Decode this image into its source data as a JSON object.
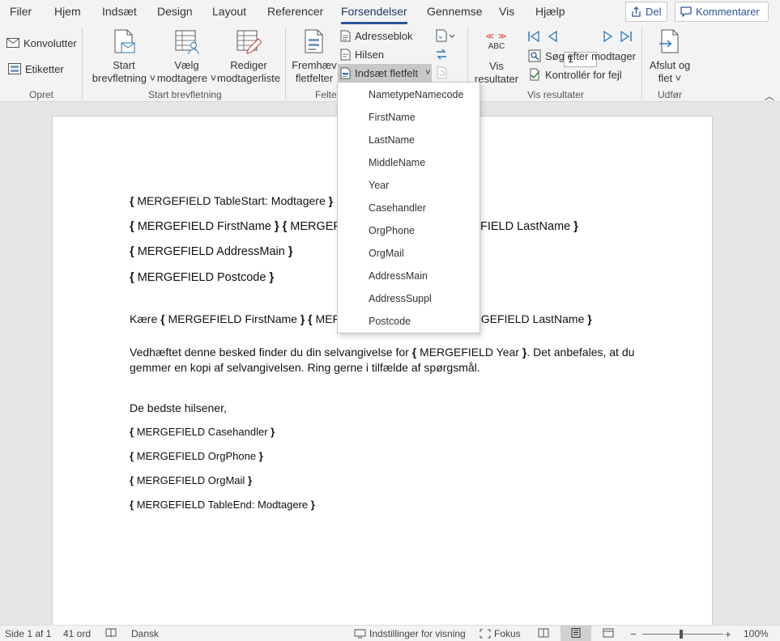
{
  "tabs": [
    "Filer",
    "Hjem",
    "Indsæt",
    "Design",
    "Layout",
    "Referencer",
    "Forsendelser",
    "Gennemse",
    "Vis",
    "Hjælp"
  ],
  "share_label": "Del",
  "comments_label": "Kommentarer",
  "groups": {
    "opret": {
      "label": "Opret",
      "envelopes": "Konvolutter",
      "labels": "Etiketter"
    },
    "start": {
      "label": "Start brevfletning",
      "start_line1": "Start",
      "start_line2": "brevfletning",
      "select_line1": "Vælg",
      "select_line2": "modtagere",
      "edit_line1": "Rediger",
      "edit_line2": "modtagerliste"
    },
    "fields": {
      "label": "Felter",
      "highlight_line1": "Fremhæv",
      "highlight_line2": "fletfelter",
      "address_block": "Adresseblok",
      "greeting": "Hilsen",
      "insert_field": "Indsæt fletfelt"
    },
    "preview": {
      "label": "Vis resultater",
      "preview_line1": "Vis",
      "preview_line2": "resultater",
      "abc_text": "ABC",
      "record_value": "1",
      "find_recipient": "Søg efter modtager",
      "check_errors": "Kontrollér for fejl"
    },
    "finish": {
      "label": "Udfør",
      "finish_line1": "Afslut og",
      "finish_line2": "flet"
    }
  },
  "dropdown_fields": [
    "NametypeNamecode",
    "FirstName",
    "LastName",
    "MiddleName",
    "Year",
    "Casehandler",
    "OrgPhone",
    "OrgMail",
    "AddressMain",
    "AddressSuppl",
    "Postcode"
  ],
  "document": {
    "table_start": "MERGEFIELD TableStart: Modtagere",
    "name_line_a": "MERGEFIELD FirstName",
    "name_line_b": "MERGEFIE",
    "name_line_c": "FIELD LastName",
    "address_main": "MERGEFIELD AddressMain",
    "postcode": "MERGEFIELD Postcode",
    "greeting_prefix": "Kære ",
    "greeting_a": "MERGEFIELD FirstName",
    "greeting_b": "MER",
    "greeting_c": "RGEFIELD LastName",
    "body_prefix": "Vedhæftet denne besked finder du din selvangivelse for ",
    "body_field": "MERGEFIELD Year",
    "body_suffix": ". Det anbefales, at du gemmer en kopi af selvangivelsen. Ring gerne i tilfælde af spørgsmål.",
    "closing": "De bedste hilsener,",
    "casehandler": "MERGEFIELD Casehandler",
    "org_phone": "MERGEFIELD OrgPhone",
    "org_mail": "MERGEFIELD OrgMail",
    "table_end": "MERGEFIELD TableEnd: Modtagere"
  },
  "status": {
    "page": "Side 1 af 1",
    "words": "41 ord",
    "language": "Dansk",
    "display_settings": "Indstillinger for visning",
    "focus": "Fokus",
    "zoom": "100%"
  },
  "colors": {
    "accent": "#2b579a",
    "ribbon_bg": "#f3f3f3",
    "canvas_bg": "#e6e6e6",
    "abc_red": "#d9372b"
  },
  "icons": [
    "envelope-icon",
    "label-icon",
    "document-mail-icon",
    "recipients-icon",
    "edit-list-icon",
    "highlight-fields-icon",
    "address-block-icon",
    "greeting-icon",
    "insert-field-icon",
    "rules-icon",
    "match-fields-icon",
    "update-labels-icon",
    "abc-preview-icon",
    "first-record-icon",
    "previous-record-icon",
    "next-record-icon",
    "last-record-icon",
    "find-recipient-icon",
    "check-errors-icon",
    "finish-merge-icon",
    "proofing-icon",
    "focus-icon",
    "read-mode-icon",
    "print-layout-icon",
    "web-layout-icon"
  ]
}
